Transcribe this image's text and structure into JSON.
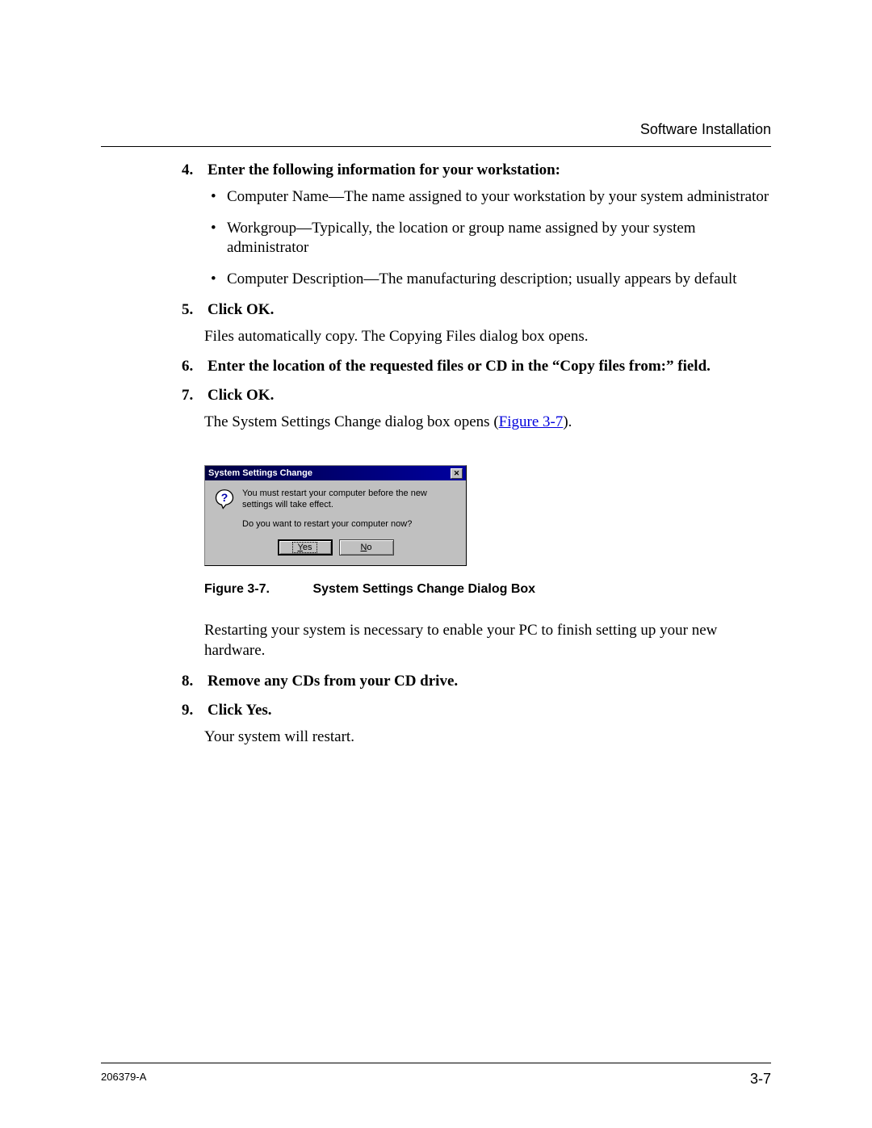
{
  "header": {
    "section_title": "Software Installation"
  },
  "steps": {
    "s4": {
      "num": "4.",
      "text": "Enter the following information for your workstation:",
      "bullets": [
        "Computer Name—The name assigned to your workstation by your system administrator",
        "Workgroup—Typically, the location or group name assigned by your system administrator",
        "Computer Description—The manufacturing description; usually appears by default"
      ]
    },
    "s5": {
      "num": "5.",
      "text": "Click OK.",
      "body": "Files automatically copy. The Copying Files dialog box opens."
    },
    "s6": {
      "num": "6.",
      "text": "Enter the location of the requested files or CD in the “Copy files from:” field."
    },
    "s7": {
      "num": "7.",
      "text": "Click OK.",
      "body_prefix": "The System Settings Change dialog box opens (",
      "link": "Figure 3-7",
      "body_suffix": ")."
    },
    "s8": {
      "num": "8.",
      "text": "Remove any CDs from your CD drive."
    },
    "s9": {
      "num": "9.",
      "text": "Click Yes.",
      "body": "Your system will restart."
    }
  },
  "dialog": {
    "title": "System Settings Change",
    "close": "✕",
    "msg1": "You must restart your computer before the new settings will take effect.",
    "msg2": "Do you want to restart your computer now?",
    "yes_prefix": "Y",
    "yes_suffix": "es",
    "no_prefix": "N",
    "no_suffix": "o"
  },
  "figure": {
    "label": "Figure 3-7.",
    "title": "System Settings Change Dialog Box"
  },
  "after_figure": "Restarting your system is necessary to enable your PC to finish setting up your new hardware.",
  "footer": {
    "doc_id": "206379-A",
    "page": "3-7"
  }
}
